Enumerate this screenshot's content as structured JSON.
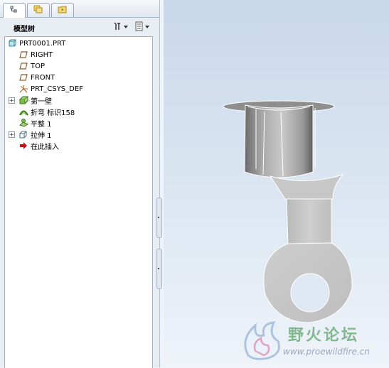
{
  "tabs": [
    {
      "icon": "model-tree-icon",
      "active": true
    },
    {
      "icon": "folder-layers-icon",
      "active": false
    },
    {
      "icon": "favorites-folder-icon",
      "active": false
    }
  ],
  "tree": {
    "title": "模型树",
    "items": [
      {
        "label": "PRT0001.PRT",
        "icon": "part-icon"
      },
      {
        "label": "RIGHT",
        "icon": "datum-plane-icon"
      },
      {
        "label": "TOP",
        "icon": "datum-plane-icon"
      },
      {
        "label": "FRONT",
        "icon": "datum-plane-icon"
      },
      {
        "label": "PRT_CSYS_DEF",
        "icon": "coordinate-system-icon"
      },
      {
        "label": "第一壁",
        "icon": "first-wall-icon"
      },
      {
        "label": "折弯 标识158",
        "icon": "bend-icon"
      },
      {
        "label": "平整 1",
        "icon": "flatten-icon"
      },
      {
        "label": "拉伸 1",
        "icon": "extrude-icon"
      },
      {
        "label": "在此插入",
        "icon": "insert-here-arrow-icon"
      }
    ]
  },
  "watermark": {
    "title": "野火论坛",
    "url": "www.proewildfire.cn"
  },
  "colors": {
    "viewport_top": "#c8d7ea",
    "viewport_bottom": "#eef3f9",
    "part_gray": "#c8c8c8",
    "insert_arrow": "#cc1010"
  }
}
